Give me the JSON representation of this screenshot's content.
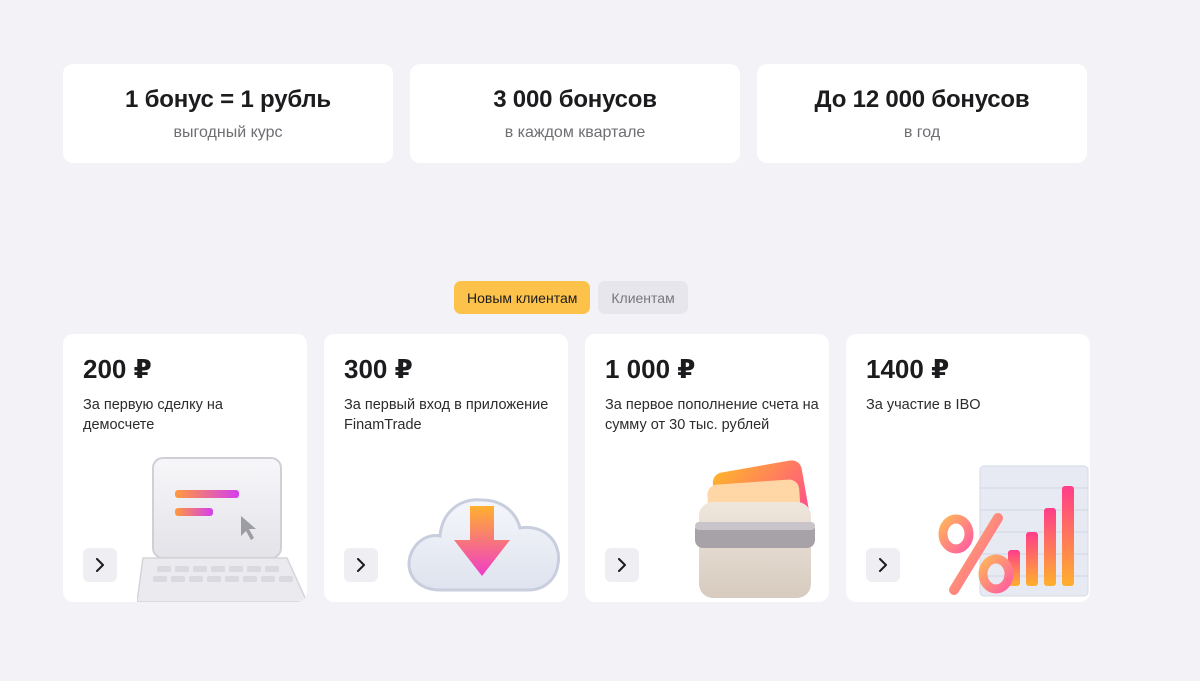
{
  "stats": [
    {
      "title": "1 бонус = 1 рубль",
      "subtitle": "выгодный курс"
    },
    {
      "title": "3 000 бонусов",
      "subtitle": "в каждом квартале"
    },
    {
      "title": "До 12 000 бонусов",
      "subtitle": "в год"
    }
  ],
  "tabs": {
    "new_clients": "Новым клиентам",
    "clients": "Клиентам"
  },
  "offers": [
    {
      "amount": "200 ₽",
      "description": "За первую сделку на демосчете",
      "icon": "laptop-icon"
    },
    {
      "amount": "300 ₽",
      "description": "За первый вход в приложение FinamTrade",
      "icon": "cloud-download-icon"
    },
    {
      "amount": "1 000 ₽",
      "description": "За первое пополнение счета на сумму от 30 тыс. рублей",
      "icon": "wallet-icon"
    },
    {
      "amount": "1400 ₽",
      "description": "За участие в IBO",
      "icon": "percent-chart-icon"
    }
  ],
  "colors": {
    "background": "#f2f2f7",
    "tab_active": "#fdc24a",
    "tab_inactive": "#e6e6ec"
  }
}
